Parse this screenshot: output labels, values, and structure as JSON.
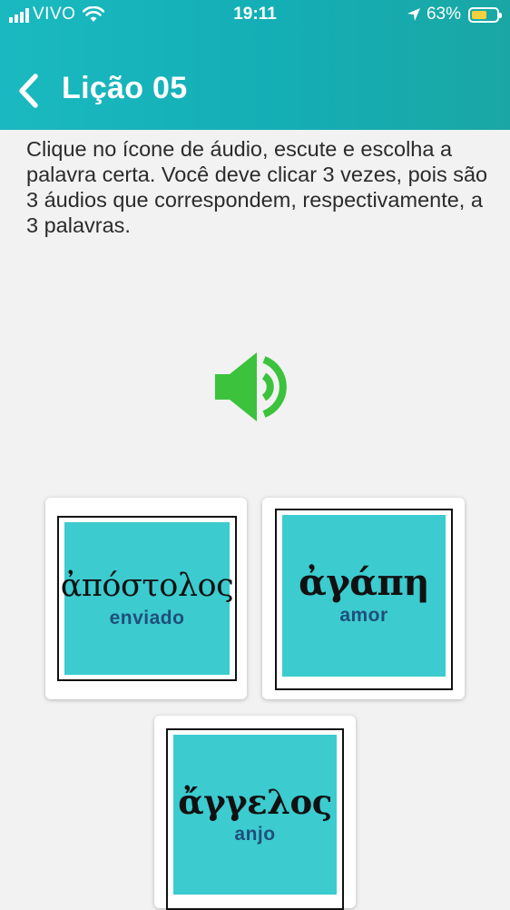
{
  "status_bar": {
    "carrier": "VIVO",
    "time": "19:11",
    "battery": "63%",
    "battery_level": 0.63
  },
  "header": {
    "title": "Lição 05"
  },
  "instructions": "Clique no ícone de áudio, escute e escolha a palavra certa. Você deve clicar 3 vezes, pois são 3 áudios que correspondem, respectivamente, a 3 palavras.",
  "colors": {
    "header": "#14aeb5",
    "tile": "#3ccbcf",
    "audio_icon": "#3cc23c",
    "gloss": "#1f4f7a"
  },
  "audio_icon": "speaker-icon",
  "cards": [
    {
      "greek": "ἀπόστολος",
      "gloss": "enviado"
    },
    {
      "greek": "ἀγάπη",
      "gloss": "amor"
    },
    {
      "greek": "ἄγγελος",
      "gloss": "anjo"
    }
  ]
}
